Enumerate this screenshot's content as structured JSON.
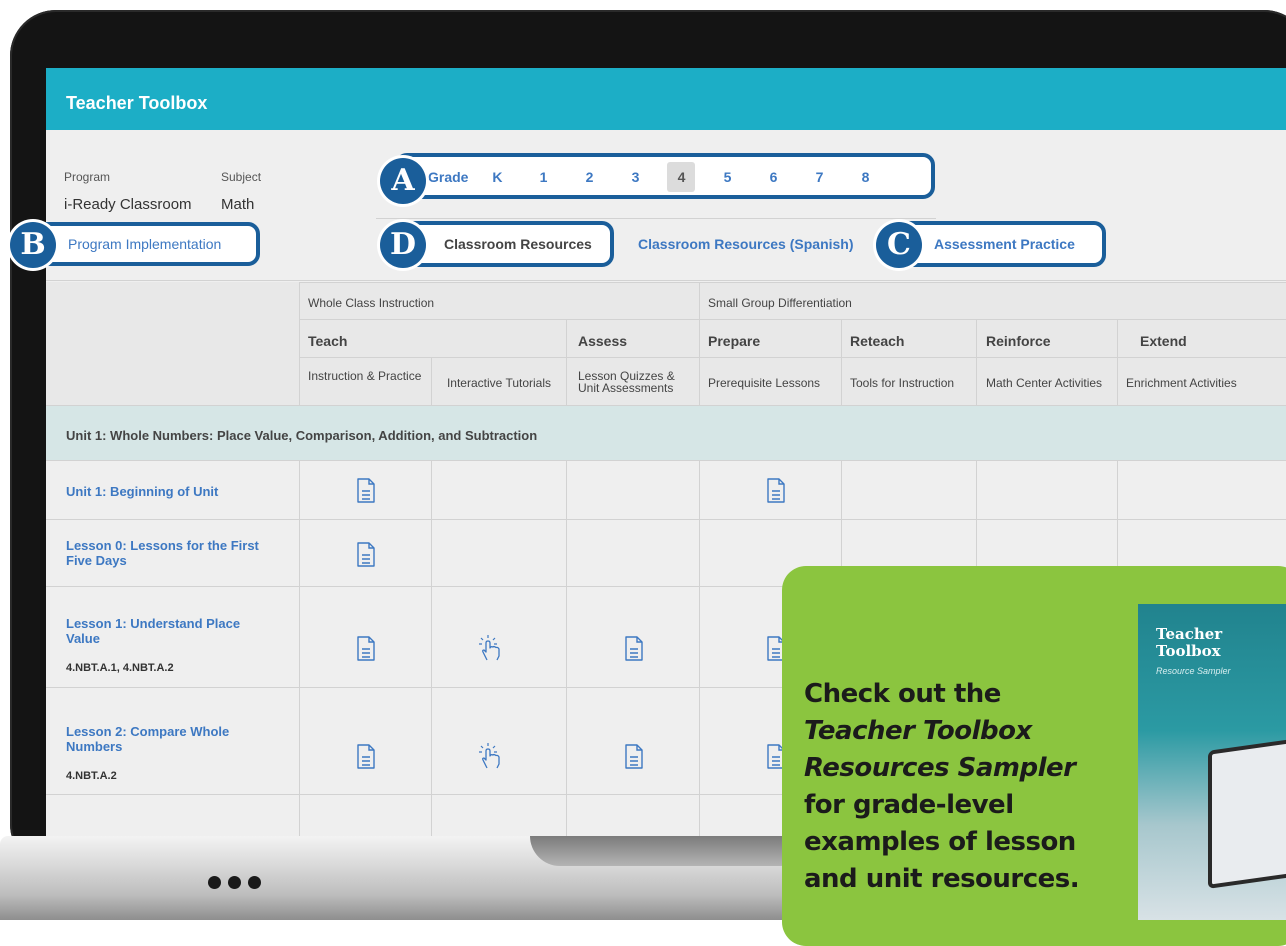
{
  "toolbox": {
    "title": "Teacher Toolbox",
    "program_label": "Program",
    "program_value": "i-Ready Classroom",
    "subject_label": "Subject",
    "subject_value": "Math",
    "implementation_link": "Program Implementation"
  },
  "grades": {
    "label": "Grade",
    "items": [
      "K",
      "1",
      "2",
      "3",
      "4",
      "5",
      "6",
      "7",
      "8"
    ],
    "selected": "4"
  },
  "tabs": {
    "classroom_resources": "Classroom Resources",
    "classroom_resources_spanish": "Classroom Resources (Spanish)",
    "assessment_practice": "Assessment Practice"
  },
  "callouts": {
    "a": "A",
    "b": "B",
    "c": "C",
    "d": "D"
  },
  "table": {
    "group_headers": [
      "Whole Class Instruction",
      "Small Group Differentiation"
    ],
    "main_headers": [
      "Teach",
      "Assess",
      "Prepare",
      "Reteach",
      "Reinforce",
      "Extend"
    ],
    "sub_headers": [
      "Instruction & Practice",
      "Interactive Tutorials",
      "Lesson Quizzes & Unit Assessments",
      "Prerequisite Lessons",
      "Tools for Instruction",
      "Math Center Activities",
      "Enrichment Activities"
    ],
    "unit_title": "Unit 1: Whole Numbers: Place Value, Comparison, Addition, and Subtraction",
    "rows": [
      {
        "label": "Unit 1: Beginning of Unit",
        "standards": ""
      },
      {
        "label": "Lesson 0: Lessons for the First Five Days",
        "standards": ""
      },
      {
        "label": "Lesson 1: Understand Place Value",
        "standards": "4.NBT.A.1, 4.NBT.A.2"
      },
      {
        "label": "Lesson 2: Compare Whole Numbers",
        "standards": "4.NBT.A.2"
      }
    ]
  },
  "promo": {
    "line1": "Check out the",
    "line2": "Teacher Toolbox",
    "line3": "Resources Sampler",
    "line4": "for grade-level",
    "line5": "examples of lesson",
    "line6": "and unit resources."
  },
  "book": {
    "title_line1": "Teacher",
    "title_line2": "Toolbox",
    "subtitle": "Resource Sampler"
  },
  "icons": {
    "document": "document-icon",
    "tutorial": "touch-hand-icon"
  },
  "colors": {
    "header": "#1caec6",
    "accent": "#1a5e9a",
    "link": "#3d78c2",
    "promo": "#8bc53f"
  }
}
